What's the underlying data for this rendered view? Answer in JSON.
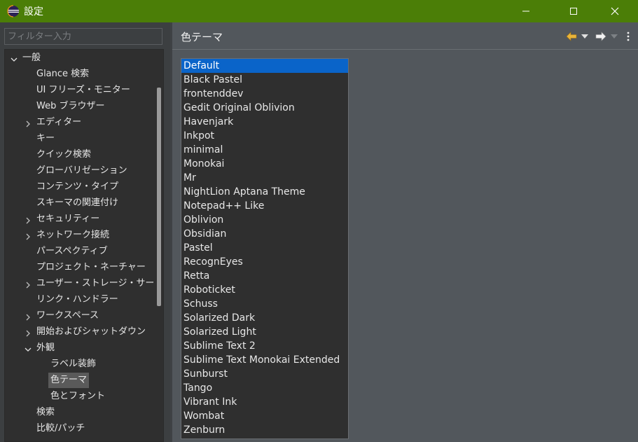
{
  "window": {
    "title": "設定"
  },
  "filter": {
    "placeholder": "フィルター入力",
    "value": ""
  },
  "tree": [
    {
      "label": "一般",
      "expanded": true,
      "hasChildren": true,
      "level": 0
    },
    {
      "label": "Glance 検索",
      "level": 1
    },
    {
      "label": "UI フリーズ・モニター",
      "level": 1
    },
    {
      "label": "Web ブラウザー",
      "level": 1
    },
    {
      "label": "エディター",
      "hasChildren": true,
      "level": 1
    },
    {
      "label": "キー",
      "level": 1
    },
    {
      "label": "クイック検索",
      "level": 1
    },
    {
      "label": "グローバリゼーション",
      "level": 1
    },
    {
      "label": "コンテンツ・タイプ",
      "level": 1
    },
    {
      "label": "スキーマの関連付け",
      "level": 1
    },
    {
      "label": "セキュリティー",
      "hasChildren": true,
      "level": 1
    },
    {
      "label": "ネットワーク接続",
      "hasChildren": true,
      "level": 1
    },
    {
      "label": "パースペクティブ",
      "level": 1
    },
    {
      "label": "プロジェクト・ネーチャー",
      "level": 1
    },
    {
      "label": "ユーザー・ストレージ・サービス",
      "hasChildren": true,
      "level": 1
    },
    {
      "label": "リンク・ハンドラー",
      "level": 1
    },
    {
      "label": "ワークスペース",
      "hasChildren": true,
      "level": 1
    },
    {
      "label": "開始およびシャットダウン",
      "hasChildren": true,
      "level": 1
    },
    {
      "label": "外観",
      "expanded": true,
      "hasChildren": true,
      "level": 1
    },
    {
      "label": "ラベル装飾",
      "level": 2
    },
    {
      "label": "色テーマ",
      "level": 2,
      "selected": true
    },
    {
      "label": "色とフォント",
      "level": 2
    },
    {
      "label": "検索",
      "level": 1
    },
    {
      "label": "比較/パッチ",
      "level": 1
    }
  ],
  "page": {
    "title": "色テーマ"
  },
  "themes": {
    "selected": "Default",
    "items": [
      "Default",
      "Black Pastel",
      "frontenddev",
      "Gedit Original Oblivion",
      "Havenjark",
      "Inkpot",
      "minimal",
      "Monokai",
      "Mr",
      "NightLion Aptana Theme",
      "Notepad++ Like",
      "Oblivion",
      "Obsidian",
      "Pastel",
      "RecognEyes",
      "Retta",
      "Roboticket",
      "Schuss",
      "Solarized Dark",
      "Solarized Light",
      "Sublime Text 2",
      "Sublime Text Monokai Extended",
      "Sunburst",
      "Tango",
      "Vibrant Ink",
      "Wombat",
      "Zenburn"
    ]
  },
  "icons": {
    "app": "eclipse-icon",
    "minimize": "minimize-icon",
    "maximize": "maximize-icon",
    "close": "close-icon",
    "back": "back-arrow-icon",
    "forward": "forward-arrow-icon",
    "menu": "view-menu-icon"
  },
  "colors": {
    "titlebar": "#4b7e07",
    "selection": "#0a64c9",
    "back_arrow": "#e8b43a"
  }
}
